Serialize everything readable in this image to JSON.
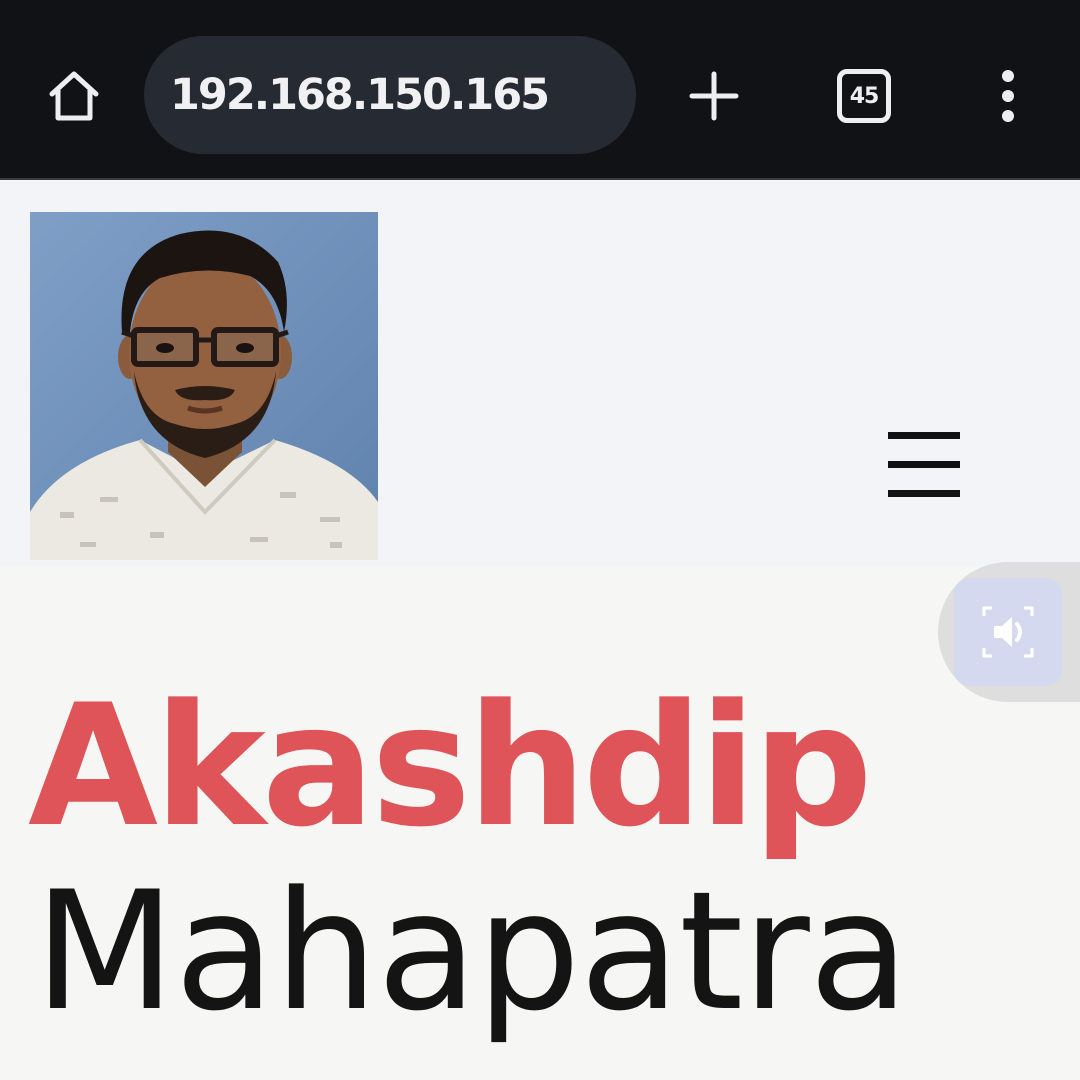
{
  "browser": {
    "url": "192.168.150.165",
    "tab_count": "45",
    "icons": {
      "home": "home-icon",
      "new_tab": "plus-icon",
      "tabs": "tab-switcher-icon",
      "menu": "more-vertical-icon"
    }
  },
  "header": {
    "photo_alt": "profile photo",
    "menu_icon": "hamburger-menu-icon"
  },
  "hero": {
    "first_name": "Akashdip",
    "last_name": "Mahapatra"
  },
  "read_aloud": {
    "icon": "speaker-icon"
  },
  "colors": {
    "toolbar_bg": "#111216",
    "url_pill_bg": "#262a33",
    "accent": "#de5459",
    "name_dark": "#141414",
    "page_bg": "#f6f6f4",
    "header_bg": "#f2f4f7",
    "float_btn_bg": "#d5d9ef"
  }
}
